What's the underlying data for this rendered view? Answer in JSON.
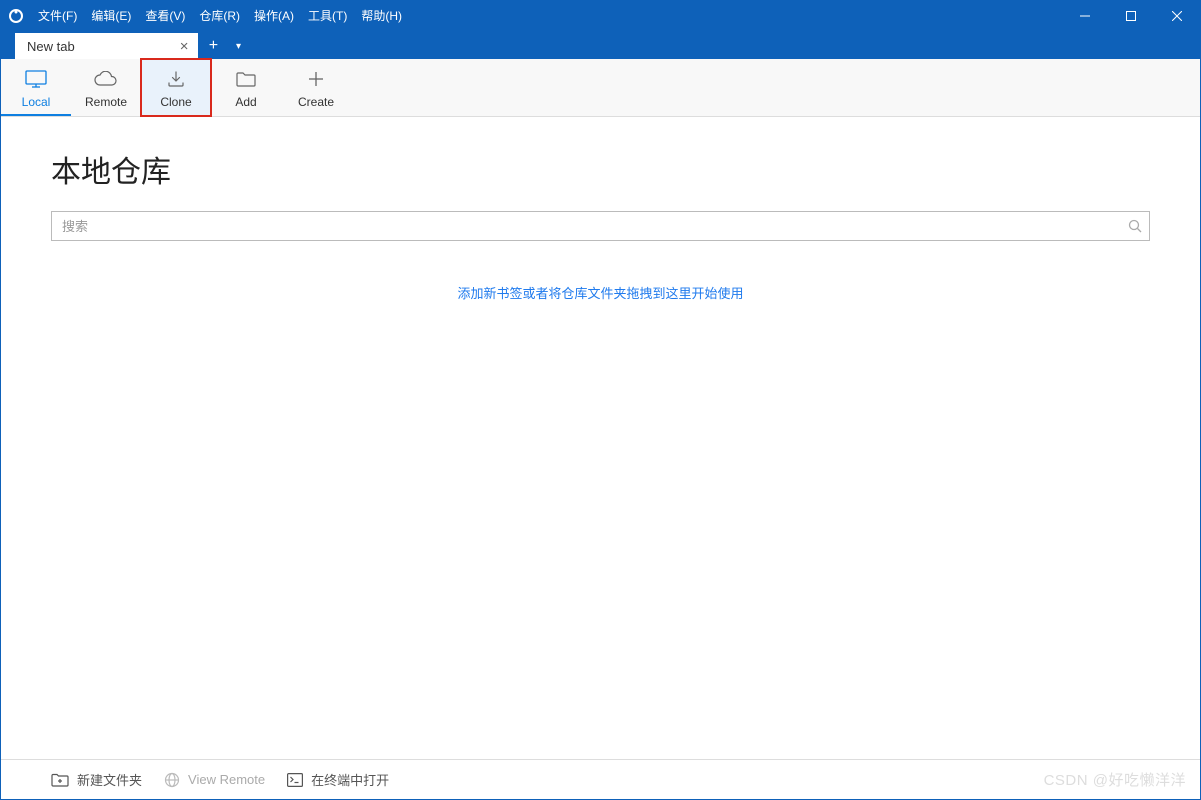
{
  "menu": {
    "file": "文件(F)",
    "edit": "编辑(E)",
    "view": "查看(V)",
    "repo": "仓库(R)",
    "action": "操作(A)",
    "tools": "工具(T)",
    "help": "帮助(H)"
  },
  "tab": {
    "label": "New tab"
  },
  "toolbar": {
    "local": "Local",
    "remote": "Remote",
    "clone": "Clone",
    "add": "Add",
    "create": "Create"
  },
  "main": {
    "heading": "本地仓库",
    "search_placeholder": "搜索",
    "hint": "添加新书签或者将仓库文件夹拖拽到这里开始使用"
  },
  "statusbar": {
    "new_folder": "新建文件夹",
    "view_remote": "View Remote",
    "open_terminal": "在终端中打开"
  },
  "watermark": "CSDN @好吃懒洋洋"
}
